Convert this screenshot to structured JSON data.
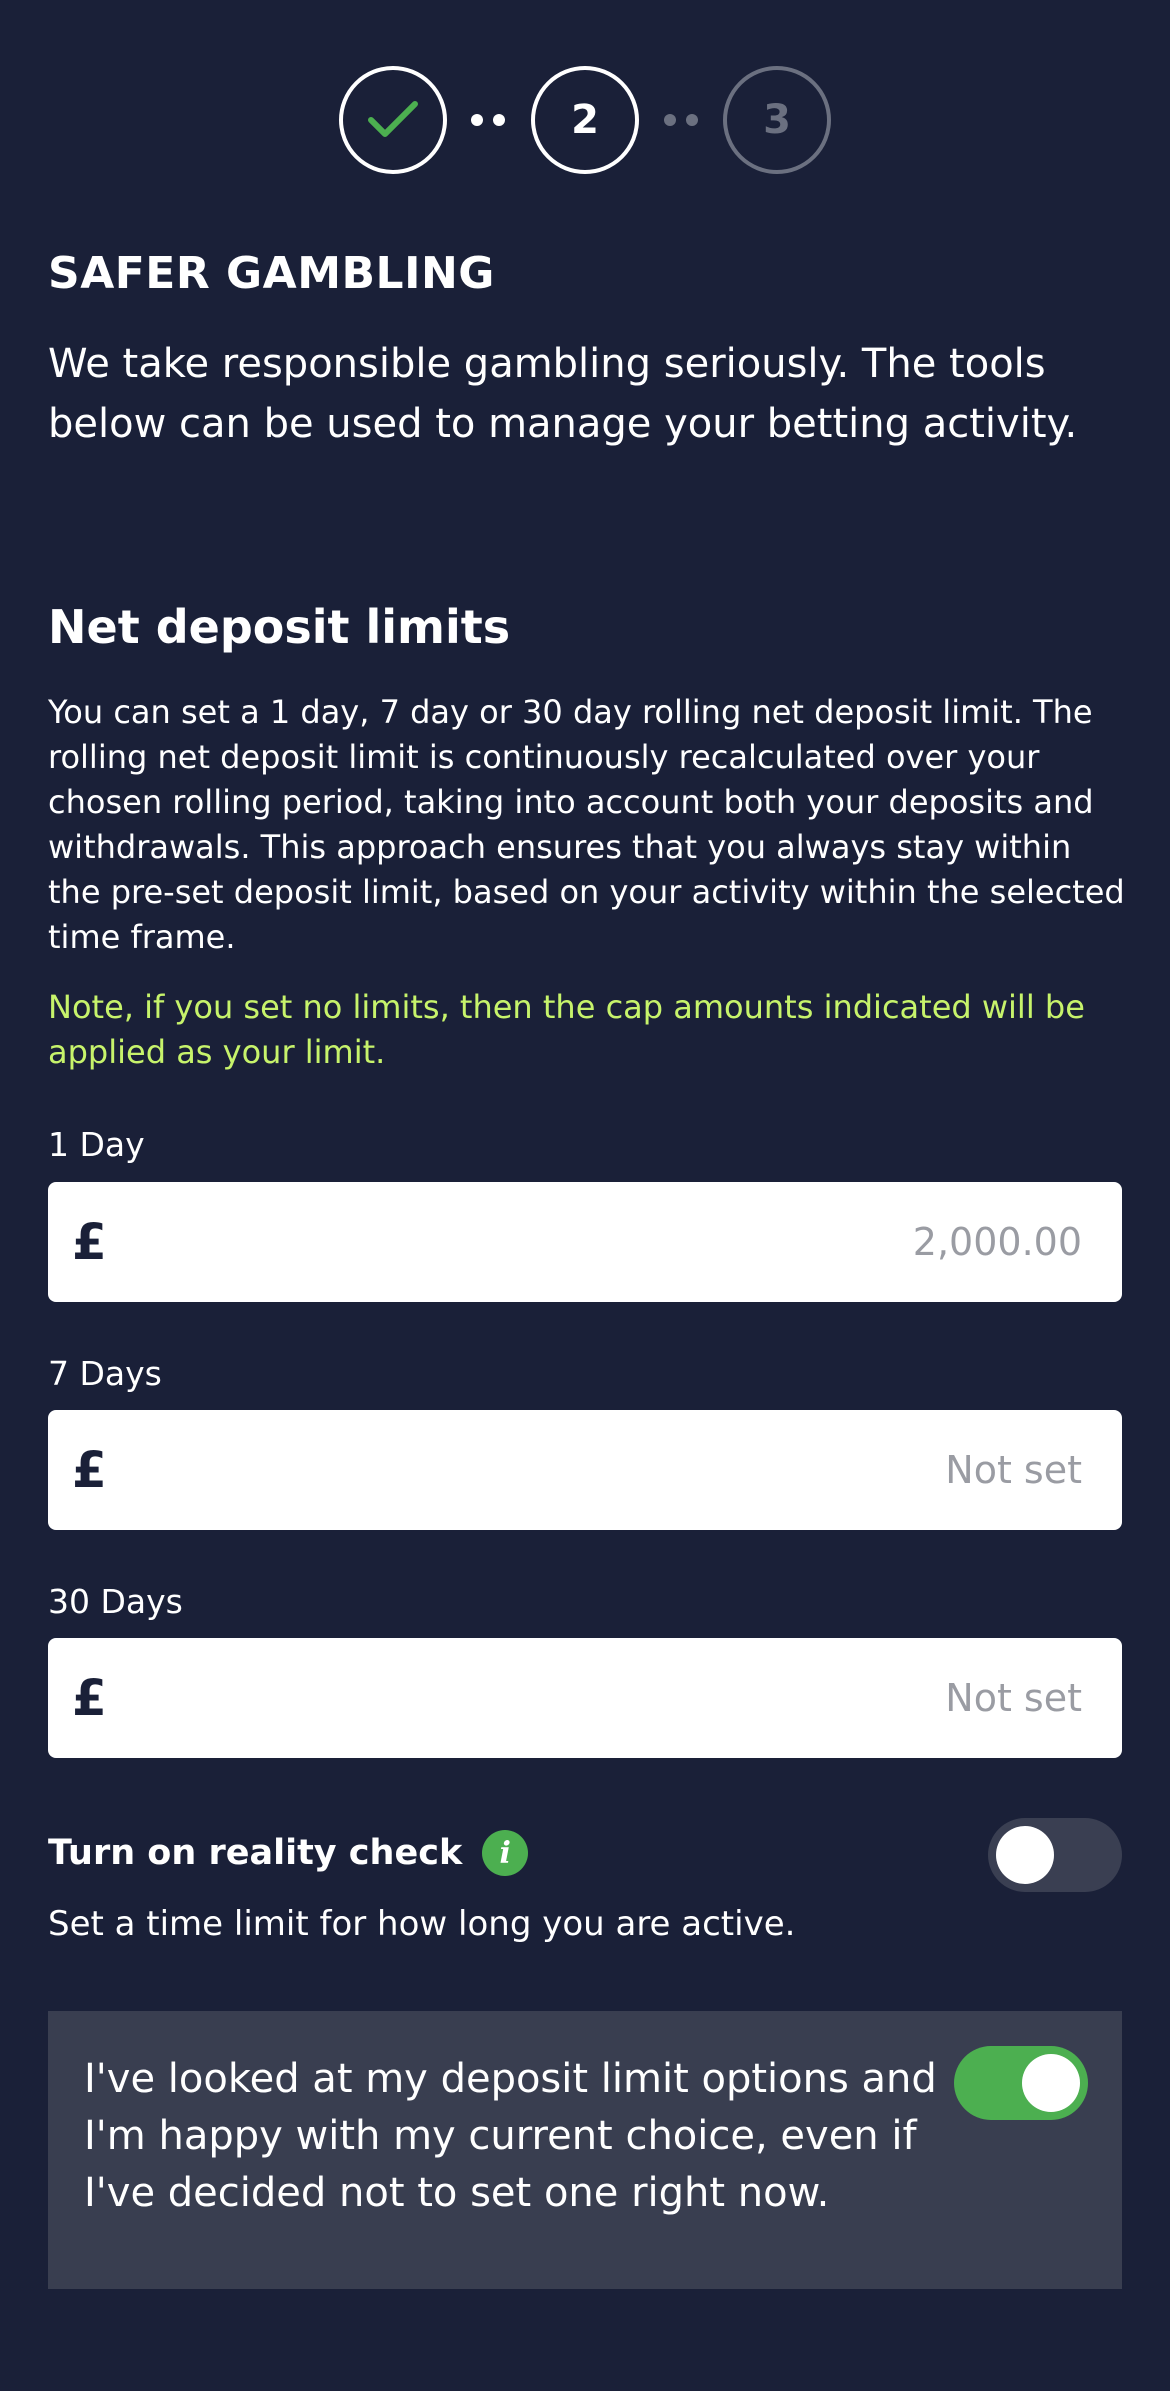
{
  "stepper": {
    "steps": [
      {
        "label": "",
        "state": "complete"
      },
      {
        "label": "2",
        "state": "current"
      },
      {
        "label": "3",
        "state": "upcoming"
      }
    ]
  },
  "header": {
    "title": "SAFER GAMBLING",
    "intro": "We take responsible gambling seriously. The tools below can be used to manage your betting activity."
  },
  "deposit_limits": {
    "title": "Net deposit limits",
    "description": "You can set a 1 day, 7 day or 30 day rolling net deposit limit. The rolling net deposit limit is continuously recalculated over your chosen rolling period, taking into account both your deposits and withdrawals. This approach ensures that you always stay within the pre-set deposit limit, based on your activity within the selected time frame.",
    "note": "Note, if you set no limits, then the cap amounts indicated will be applied as your limit.",
    "currency_symbol": "£",
    "fields": [
      {
        "label": "1 Day",
        "placeholder": "2,000.00",
        "value": ""
      },
      {
        "label": "7 Days",
        "placeholder": "Not set",
        "value": ""
      },
      {
        "label": "30 Days",
        "placeholder": "Not set",
        "value": ""
      }
    ]
  },
  "reality_check": {
    "label": "Turn on reality check",
    "info_icon": "i",
    "description": "Set a time limit for how long you are active.",
    "enabled": false
  },
  "confirmation": {
    "text": "I've looked at my deposit limit options and I'm happy with my current choice, even if I've decided not to set one right now.",
    "enabled": true
  },
  "colors": {
    "background": "#1a2038",
    "accent_green": "#4caf50",
    "note_color": "#c7f36b",
    "panel": "#393e50"
  }
}
